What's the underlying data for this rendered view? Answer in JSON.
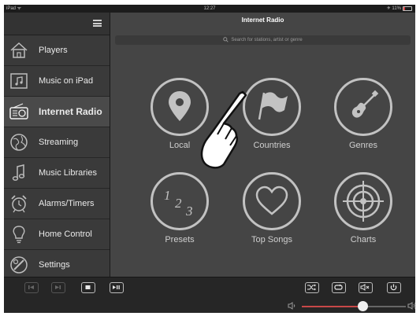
{
  "statusbar": {
    "carrier": "iPad ᯤ",
    "time": "12:27",
    "battery": "✈ 11%"
  },
  "main": {
    "title": "Internet Radio",
    "search_placeholder": "Search for stations, artist or genre"
  },
  "sidebar": {
    "items": [
      {
        "label": "Players",
        "icon": "house-icon"
      },
      {
        "label": "Music on iPad",
        "icon": "music-note-icon"
      },
      {
        "label": "Internet Radio",
        "icon": "radio-icon",
        "active": true
      },
      {
        "label": "Streaming",
        "icon": "globe-icon"
      },
      {
        "label": "Music Libraries",
        "icon": "music-note-icon"
      },
      {
        "label": "Alarms/Timers",
        "icon": "alarm-clock-icon"
      },
      {
        "label": "Home Control",
        "icon": "lightbulb-icon"
      },
      {
        "label": "Settings",
        "icon": "settings-icon"
      }
    ]
  },
  "tiles": [
    {
      "label": "Local",
      "icon": "location-pin-icon"
    },
    {
      "label": "Countries",
      "icon": "flag-icon"
    },
    {
      "label": "Genres",
      "icon": "guitar-icon"
    },
    {
      "label": "Presets",
      "icon": "presets-123-icon",
      "glyph": "1 2 3"
    },
    {
      "label": "Top Songs",
      "icon": "heart-icon"
    },
    {
      "label": "Charts",
      "icon": "target-icon"
    }
  ],
  "volume": {
    "level": 0.58,
    "accent": "#c84848"
  }
}
